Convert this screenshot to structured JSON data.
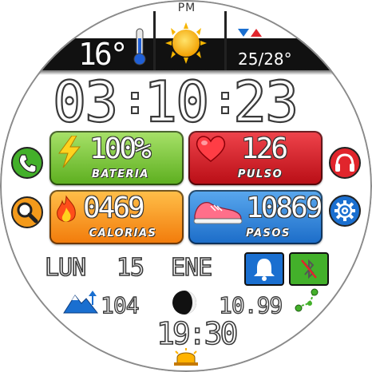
{
  "weather": {
    "period": "PM",
    "temperature": "16°",
    "range": "25/28°",
    "condition_icon": "sun-icon",
    "thermometer_icon": "thermometer-icon"
  },
  "clock": {
    "hours": "03",
    "minutes": "10",
    "seconds": "23"
  },
  "tiles": {
    "battery": {
      "value": "100%",
      "label": "BATERIA",
      "icon": "lightning-icon",
      "color": "#6cc02a"
    },
    "pulse": {
      "value": "126",
      "label": "PULSO",
      "icon": "heart-icon",
      "color": "#d81c24"
    },
    "calories": {
      "value": "0469",
      "label": "CALORIAS",
      "icon": "flame-icon",
      "color": "#f58c12"
    },
    "steps": {
      "value": "10869",
      "label": "PASOS",
      "icon": "sneaker-icon",
      "color": "#2a7fd8"
    }
  },
  "side_buttons": {
    "phone": "phone-icon",
    "search": "search-icon",
    "music": "headphones-icon",
    "settings": "gear-icon"
  },
  "date": {
    "weekday": "LUN",
    "day": "15",
    "month": "ENE"
  },
  "status": {
    "notification_icon": "bell-icon",
    "bluetooth_icon": "bluetooth-off-icon"
  },
  "stats": {
    "altitude": "104",
    "distance": "10.99",
    "altitude_icon": "mountain-icon",
    "moon_icon": "moon-phase-icon",
    "distance_icon": "route-icon"
  },
  "alarm": {
    "time": "19:30",
    "icon": "alarm-light-icon"
  },
  "colors": {
    "top_bar": "#111111",
    "accent_red": "#e1252c",
    "accent_blue": "#1a6fd0",
    "phone_green": "#43b02a",
    "search_orange": "#f39a1b",
    "music_red": "#e1252c",
    "settings_blue": "#1a6fd0"
  }
}
